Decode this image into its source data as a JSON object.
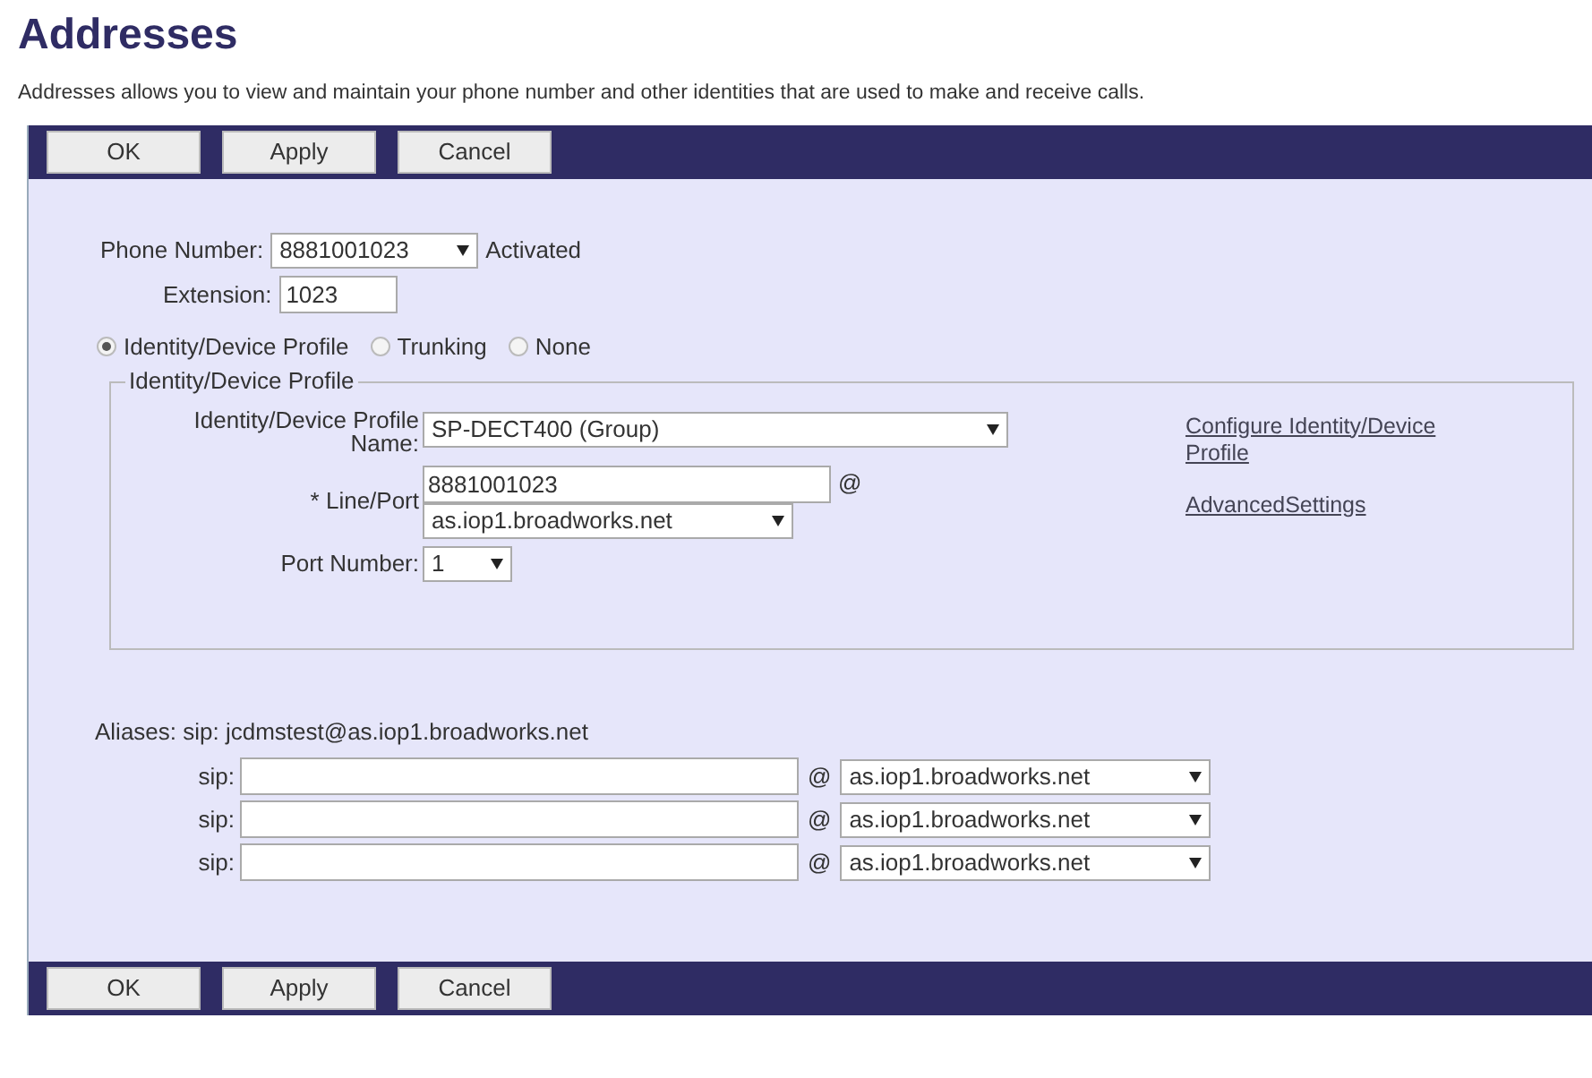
{
  "title": "Addresses",
  "description": "Addresses allows you to view and maintain your phone number and other identities that are used to make and receive calls.",
  "top_buttons": [
    "OK",
    "Apply",
    "Cancel"
  ],
  "phone_number": {
    "label": "Phone Number:",
    "value": "8881001023",
    "status": "Activated"
  },
  "extension": {
    "label": "Extension:",
    "value": "1023"
  },
  "modes": [
    {
      "label": "Identity/Device Profile",
      "selected": true
    },
    {
      "label": "Trunking",
      "selected": false
    },
    {
      "label": "None",
      "selected": false
    }
  ],
  "profile_group": {
    "legend": "Identity/Device Profile",
    "profile_name": {
      "label_line1": "Identity/Device Profile",
      "label_line2": "Name:",
      "value": "SP-DECT400 (Group)"
    },
    "line_port": {
      "label": "* Line/Port",
      "value": "8881001023",
      "at": "@",
      "domain": "as.iop1.broadworks.net"
    },
    "port_number": {
      "label": "Port Number:",
      "value": "1"
    },
    "links": [
      "Configure Identity/Device Profile",
      "AdvancedSettings"
    ]
  },
  "aliases": {
    "label": "Aliases: sip: jcdmstest@as.iop1.broadworks.net",
    "rows": [
      {
        "prefix": "sip:",
        "at": "@",
        "domain": "as.iop1.broadworks.net"
      },
      {
        "prefix": "sip:",
        "at": "@",
        "domain": "as.iop1.broadworks.net"
      },
      {
        "prefix": "sip:",
        "at": "@",
        "domain": "as.iop1.broadworks.net"
      }
    ]
  },
  "bottom_buttons": [
    "OK",
    "Apply",
    "Cancel"
  ]
}
